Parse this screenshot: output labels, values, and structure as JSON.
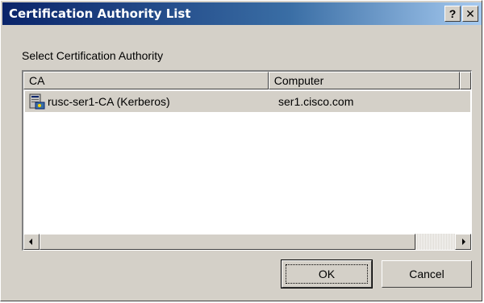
{
  "window": {
    "title": "Certification Authority List",
    "help_button": "?",
    "close_button": "✕"
  },
  "prompt_label": "Select Certification Authority",
  "list": {
    "columns": [
      "CA",
      "Computer"
    ],
    "rows": [
      {
        "ca": "rusc-ser1-CA (Kerberos)",
        "computer": "ser1.cisco.com",
        "icon": "certificate-server-icon",
        "selected": true
      }
    ]
  },
  "buttons": {
    "ok": "OK",
    "cancel": "Cancel"
  },
  "colors": {
    "title_start": "#0a246a",
    "title_end": "#a6caf0",
    "dialog_face": "#d4d0c8"
  }
}
